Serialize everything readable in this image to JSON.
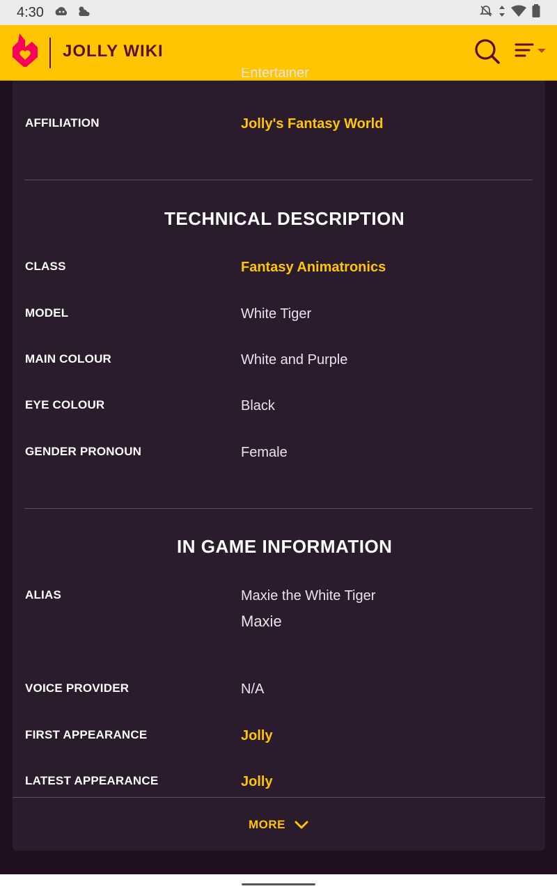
{
  "status_bar": {
    "time": "4:30",
    "left_icons": [
      "cloud-game-icon",
      "weather-partly-cloudy-icon"
    ],
    "right_icons": [
      "notifications-off-icon",
      "data-arrows-icon",
      "wifi-icon",
      "battery-icon"
    ]
  },
  "header": {
    "wiki_name": "JOLLY WIKI",
    "brand_color": "#ffc500",
    "text_color": "#5a0f2e"
  },
  "infobox": {
    "clipped_value": "Entertainer",
    "affiliation": {
      "label": "AFFILIATION",
      "value": "Jolly's Fantasy World"
    },
    "technical": {
      "title": "TECHNICAL DESCRIPTION",
      "rows": [
        {
          "label": "CLASS",
          "value": "Fantasy Animatronics"
        },
        {
          "label": "MODEL",
          "value": "White Tiger"
        },
        {
          "label": "MAIN COLOUR",
          "value": "White and Purple"
        },
        {
          "label": "EYE COLOUR",
          "value": "Black"
        },
        {
          "label": "GENDER PRONOUN",
          "value": "Female"
        }
      ]
    },
    "in_game": {
      "title": "IN GAME INFORMATION",
      "alias": {
        "label": "ALIAS",
        "value_1": "Maxie the White Tiger",
        "value_2": "Maxie"
      },
      "voice": {
        "label": "VOICE PROVIDER",
        "value": "N/A"
      },
      "first": {
        "label": "FIRST APPEARANCE",
        "value": "Jolly"
      },
      "latest": {
        "label": "LATEST APPEARANCE",
        "value": "Jolly"
      }
    },
    "more_label": "MORE"
  }
}
